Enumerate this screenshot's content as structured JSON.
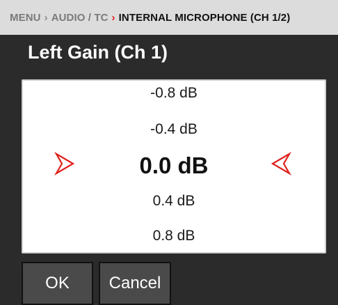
{
  "breadcrumb": {
    "items": [
      "MENU",
      "AUDIO / TC",
      "INTERNAL MICROPHONE (CH 1/2)"
    ],
    "separator_gray": "›",
    "separator_red": "›",
    "accent_color": "#e0201b"
  },
  "title": "Left Gain (Ch 1)",
  "picker": {
    "values": [
      "-0.8 dB",
      "-0.4 dB",
      "0.0 dB",
      "0.4 dB",
      "0.8 dB"
    ],
    "selected": "0.0 dB",
    "left_icon": "chevron-right-outline-icon",
    "right_icon": "chevron-left-outline-icon"
  },
  "buttons": {
    "ok_label": "OK",
    "cancel_label": "Cancel"
  }
}
